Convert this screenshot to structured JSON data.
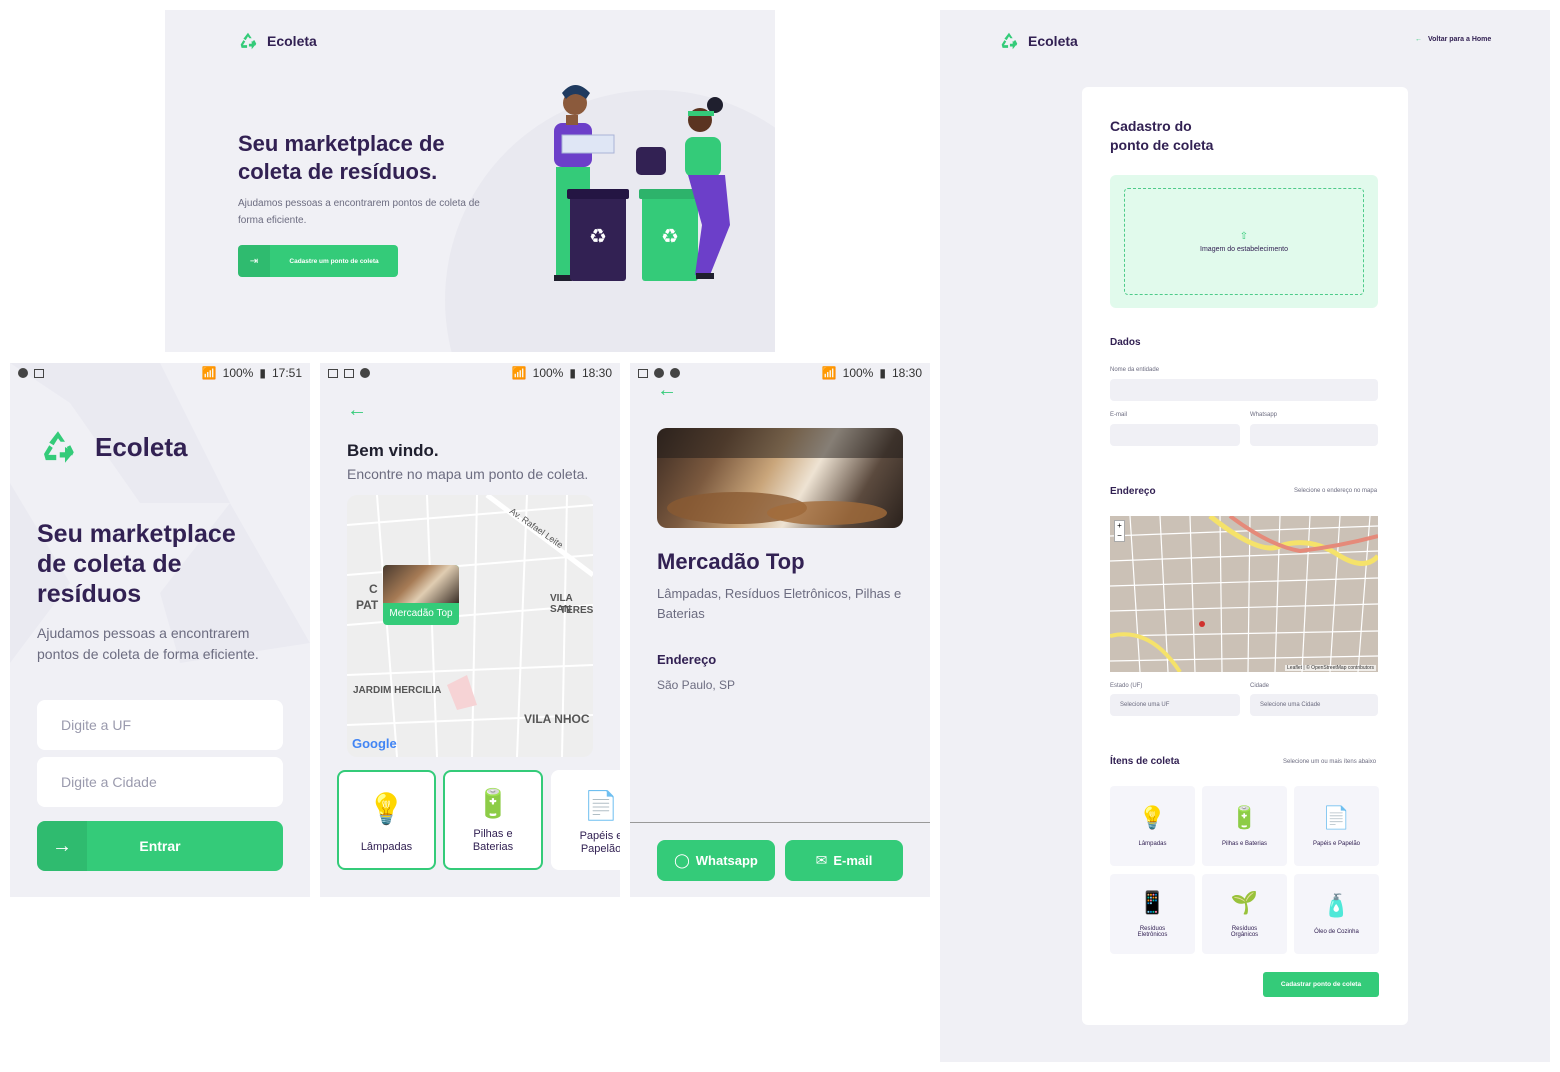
{
  "colors": {
    "primary": "#34cb79",
    "title": "#322153",
    "text": "#6c6c80",
    "background": "#f0f0f5"
  },
  "web_home": {
    "logo_text": "Ecoleta",
    "title_line1": "Seu marketplace de",
    "title_line2": "coleta de resíduos.",
    "description": "Ajudamos pessoas a encontrarem pontos de coleta de forma eficiente.",
    "cta_label": "Cadastre um ponto de coleta",
    "cta_icon": "log-in-icon"
  },
  "web_create": {
    "logo_text": "Ecoleta",
    "back_link": "Voltar para a Home",
    "title_line1": "Cadastro do",
    "title_line2": "ponto de coleta",
    "dropzone_label": "Imagem do estabelecimento",
    "dados_title": "Dados",
    "name_label": "Nome da entidade",
    "email_label": "E-mail",
    "whatsapp_label": "Whatsapp",
    "endereco_title": "Endereço",
    "endereco_hint": "Selecione o endereço no mapa",
    "estado_label": "Estado (UF)",
    "cidade_label": "Cidade",
    "estado_select": "Selecione uma UF",
    "cidade_select": "Selecione uma Cidade",
    "map_zoom_in": "+",
    "map_zoom_out": "−",
    "map_attribution": "Leaflet | © OpenStreetMap contributors",
    "itens_title": "Ítens de coleta",
    "itens_hint": "Selecione um ou mais ítens abaixo",
    "items": [
      {
        "label": "Lâmpadas",
        "icon": "lamp-icon"
      },
      {
        "label": "Pilhas e Baterias",
        "icon": "battery-icon"
      },
      {
        "label": "Papéis e Papelão",
        "icon": "paper-icon"
      },
      {
        "label": "Resíduos Eletrônicos",
        "icon": "electronics-icon"
      },
      {
        "label": "Resíduos Orgânicos",
        "icon": "organic-icon"
      },
      {
        "label": "Óleo de Cozinha",
        "icon": "oil-icon"
      }
    ],
    "submit_label": "Cadastrar ponto de coleta"
  },
  "mobile_home": {
    "status": {
      "battery": "100%",
      "time": "17:51"
    },
    "logo_text": "Ecoleta",
    "title_line1": "Seu marketplace",
    "title_line2": "de coleta de",
    "title_line3": "resíduos",
    "description_line1": "Ajudamos pessoas a encontrarem",
    "description_line2": "pontos de coleta de forma eficiente.",
    "uf_placeholder": "Digite a UF",
    "city_placeholder": "Digite a Cidade",
    "enter_label": "Entrar"
  },
  "mobile_map": {
    "status": {
      "battery": "100%",
      "time": "18:30"
    },
    "title": "Bem vindo.",
    "subtitle": "Encontre no mapa um ponto de coleta.",
    "marker_label": "Mercadão Top",
    "map_labels": [
      "Av. Rafael Leite",
      "VILA SAN",
      "TERES",
      "JARDIM HERCILIA",
      "VILA NHOC",
      "C",
      "PAT"
    ],
    "google_logo": "Google",
    "items": [
      {
        "label_line1": "Lâmpadas",
        "label_line2": "",
        "icon": "lamp-icon"
      },
      {
        "label_line1": "Pilhas e",
        "label_line2": "Baterias",
        "icon": "battery-icon"
      },
      {
        "label_line1": "Papéis e",
        "label_line2": "Papelão",
        "icon": "paper-icon"
      }
    ]
  },
  "mobile_detail": {
    "status": {
      "battery": "100%",
      "time": "18:30"
    },
    "point_name": "Mercadão Top",
    "items_line1": "Lâmpadas, Resíduos Eletrônicos, Pilhas e",
    "items_line2": "Baterias",
    "address_title": "Endereço",
    "address": "São Paulo, SP",
    "whatsapp_label": "Whatsapp",
    "email_label": "E-mail"
  }
}
